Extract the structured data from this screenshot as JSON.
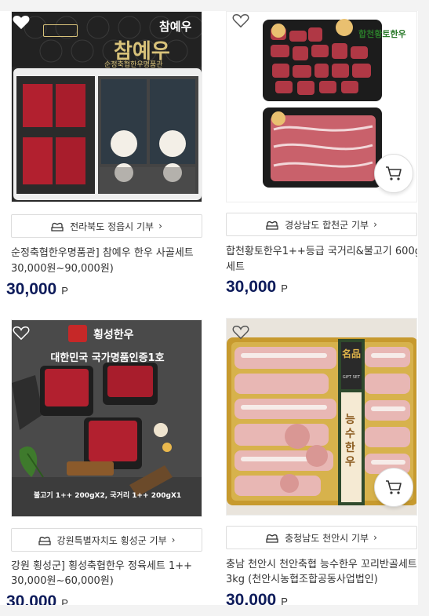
{
  "products": [
    {
      "region_label": "전라북도 정읍시 기부",
      "title_line1": "순정축협한우명품관] 참예우 한우 사골세트",
      "title_line2": "30,000원~90,000원)",
      "price": "30,000",
      "price_unit": "P",
      "brand_text": "참예우",
      "brand_sub": "순정축협한우명품관",
      "liked": true,
      "has_cart": false
    },
    {
      "region_label": "경상남도 합천군 기부",
      "title_line1": "합천황토한우1++등급 국거리&불고기 600g",
      "title_line2": "세트",
      "price": "30,000",
      "price_unit": "P",
      "brand_text": "합천황토한우",
      "liked": false,
      "has_cart": true
    },
    {
      "region_label": "강원특별자치도 횡성군 기부",
      "title_line1": "강원 횡성군] 횡성축협한우 정육세트 1++",
      "title_line2": "30,000원~60,000원)",
      "price": "30,000",
      "price_unit": "P",
      "brand_text": "횡성한우",
      "banner_text": "대한민국 국가명품인증1호",
      "caption_text": "불고기 1++ 200gX2, 국거리 1++ 200gX1",
      "liked": false,
      "has_cart": false
    },
    {
      "region_label": "충청남도 천안시 기부",
      "title_line1": "충남 천안시 천안축협 능수한우 꼬리반골세트",
      "title_line2": "3kg (천안시농협조합공동사업법인)",
      "price": "30,000",
      "price_unit": "P",
      "brand_text": "능수한우",
      "label_top": "名品",
      "label_sub": "GIFT SET",
      "liked": false,
      "has_cart": true
    }
  ],
  "colors": {
    "price": "#0d1b5a",
    "heart_outline": "#555555",
    "border": "#dddddd"
  }
}
